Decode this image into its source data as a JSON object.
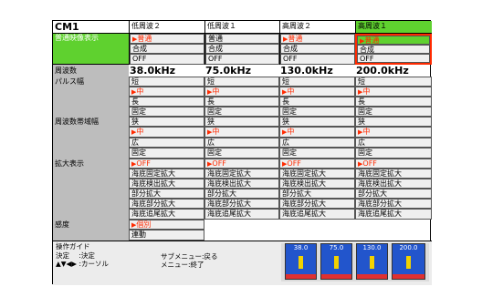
{
  "menu": {
    "title": "CM1",
    "columns": [
      {
        "label": "低周波２",
        "active": false
      },
      {
        "label": "低周波１",
        "active": false
      },
      {
        "label": "高周波２",
        "active": false
      },
      {
        "label": "高周波１",
        "active": true
      }
    ]
  },
  "rows": {
    "normal_display": {
      "label": "普通映像表示",
      "options": [
        "普通",
        "合成",
        "OFF"
      ]
    },
    "frequency": {
      "label": "周波数",
      "values": [
        "38.0kHz",
        "75.0kHz",
        "130.0kHz",
        "200.0kHz"
      ]
    },
    "pulse_width": {
      "label": "パルス幅",
      "options": [
        "短",
        "中",
        "長",
        "固定"
      ],
      "selected_index": 1
    },
    "bandwidth": {
      "label": "周波数帯域幅",
      "options": [
        "狭",
        "中",
        "広",
        "固定"
      ],
      "selected_index": 1
    },
    "zoom": {
      "label": "拡大表示",
      "options": [
        "OFF",
        "海底固定拡大",
        "海底検出拡大",
        "部分拡大",
        "海底部分拡大",
        "海底追尾拡大"
      ],
      "selected_index": 0
    },
    "sensitivity": {
      "label": "感度",
      "options": [
        "個別",
        "連動"
      ],
      "selected_index": 0
    }
  },
  "guide": {
    "title": "操作ガイド",
    "lines": [
      {
        "key": "決定",
        "action": ":決定"
      },
      {
        "key": "▲▼◀▶",
        "action": ":カーソル"
      }
    ],
    "sub_lines": [
      "サブメニュー:戻る",
      "メニュー:終了"
    ]
  },
  "thumbnails": [
    "38.0",
    "75.0",
    "130.0",
    "200.0"
  ],
  "colors": {
    "accent": "#5fd12f",
    "selection": "#ff2a00",
    "gray": "#bdbdbd"
  }
}
